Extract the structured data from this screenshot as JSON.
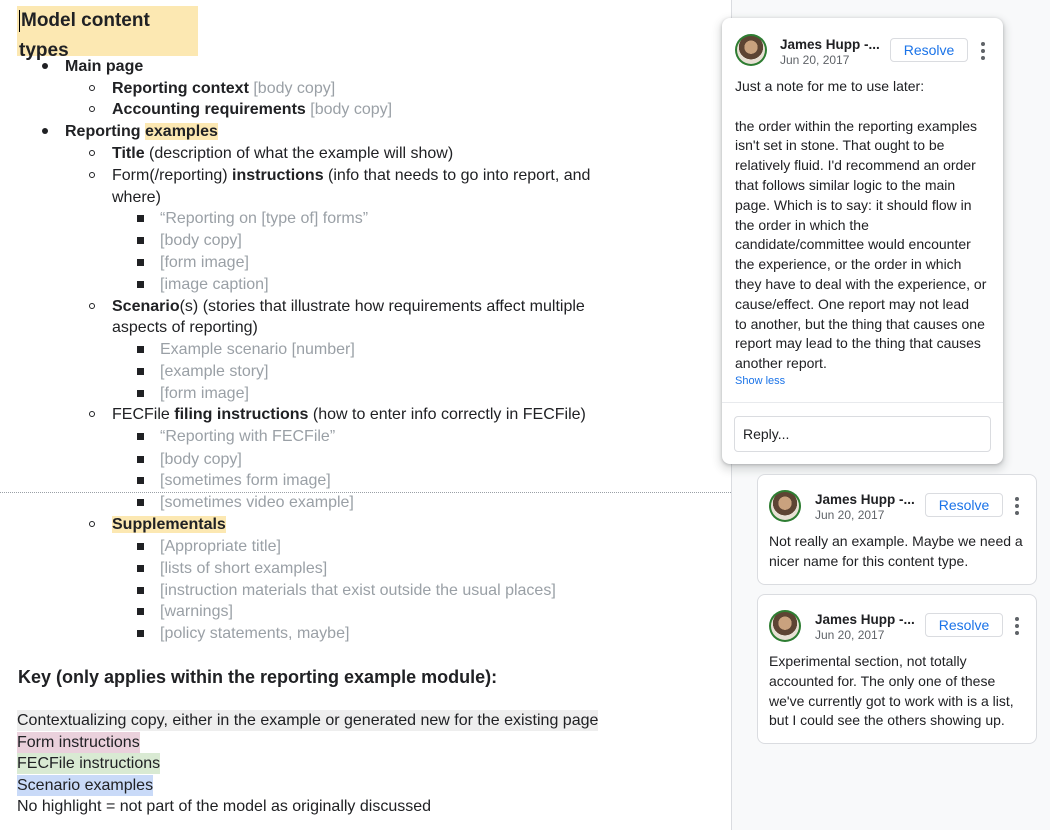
{
  "doc": {
    "title": "Model content types",
    "outline": {
      "main_page": "Main page",
      "reporting_context": "Reporting context",
      "reporting_context_note": "[body copy]",
      "accounting_requirements": "Accounting requirements",
      "accounting_requirements_note": "[body copy]",
      "reporting_prefix": "Reporting ",
      "reporting_examples": "examples",
      "title_item": "Title",
      "title_item_desc": " (description of what the example will show)",
      "form_prefix": "Form(/reporting) ",
      "form_instructions": "instructions",
      "form_desc_1": " (info that needs to go into report, and",
      "form_desc_2": "where)",
      "form_children": [
        "“Reporting on [type of] forms”",
        "[body copy]",
        "[form image]",
        "[image caption]"
      ],
      "scenario_bold": "Scenario",
      "scenario_desc_1": "(s) (stories that illustrate how requirements affect multiple",
      "scenario_desc_2": "aspects of reporting)",
      "scenario_children": [
        "Example scenario [number]",
        "[example story]",
        "[form image]"
      ],
      "fecfile_prefix": "FECFile ",
      "fecfile_bold": "filing instructions",
      "fecfile_desc": " (how to enter info correctly in FECFile)",
      "fecfile_children": [
        "“Reporting with FECFile”",
        "[body copy]",
        "[sometimes form image]",
        "[sometimes video example]"
      ],
      "supplementals": "Supplementals",
      "supplementals_children": [
        "[Appropriate title]",
        "[lists of short examples]",
        "[instruction materials that exist outside the usual places]",
        "[warnings]",
        "[policy statements, maybe]"
      ]
    },
    "key": {
      "heading": "Key (only applies within the reporting example module):",
      "items": [
        {
          "text": "Contextualizing copy, either in the example or generated new for the existing page",
          "color": "#eeeeee"
        },
        {
          "text": "Form instructions",
          "color": "#ead1dc"
        },
        {
          "text": "FECFile instructions",
          "color": "#d9ead3"
        },
        {
          "text": "Scenario examples",
          "color": "#c9daf8"
        },
        {
          "text": "No highlight = not part of the model as originally discussed",
          "color": "#ffffff"
        }
      ]
    }
  },
  "comments": [
    {
      "author": "James Hupp -...",
      "date": "Jun 20, 2017",
      "resolve_label": "Resolve",
      "text": "Just a note for me to use later:\n\nthe order within the reporting examples\nisn't set in stone. That ought to be\nrelatively fluid. I'd recommend an order\nthat follows similar logic to the main\npage. Which is to say: it should flow in\nthe order in which the\ncandidate/committee would encounter\nthe experience, or the order in which\nthey have to deal with the experience, or\ncause/effect. One report may not lead\nto another, but the thing that causes one\nreport may lead to the thing that causes\nanother report.",
      "show_less": "Show less",
      "reply_placeholder": "Reply..."
    },
    {
      "author": "James Hupp -...",
      "date": "Jun 20, 2017",
      "resolve_label": "Resolve",
      "text": "Not really an example. Maybe we need a\nnicer name for this content type."
    },
    {
      "author": "James Hupp -...",
      "date": "Jun 20, 2017",
      "resolve_label": "Resolve",
      "text": "Experimental section, not totally\naccounted for. The only one of these\nwe've currently got to work with is a list,\nbut I could see the others showing up."
    }
  ]
}
